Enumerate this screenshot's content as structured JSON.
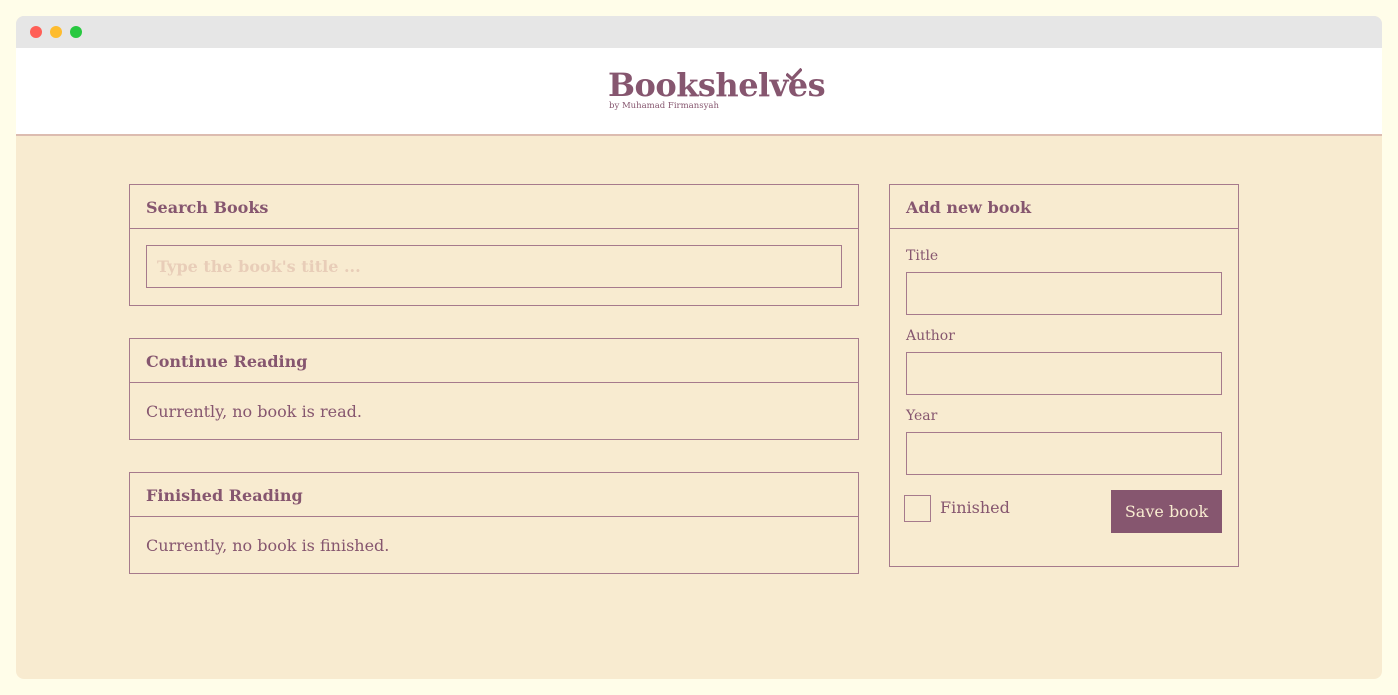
{
  "brand": {
    "title": "Bookshelves",
    "subtitle": "by Muhamad Firmansyah",
    "accent_color": "#86566f",
    "check_icon": "check-icon"
  },
  "search": {
    "heading": "Search Books",
    "placeholder": "Type the book's title ...",
    "value": ""
  },
  "continue_reading": {
    "heading": "Continue Reading",
    "empty_text": "Currently, no book is read."
  },
  "finished_reading": {
    "heading": "Finished Reading",
    "empty_text": "Currently, no book is finished."
  },
  "add_book": {
    "heading": "Add new book",
    "title_label": "Title",
    "title_value": "",
    "author_label": "Author",
    "author_value": "",
    "year_label": "Year",
    "year_value": "",
    "finished_label": "Finished",
    "finished_checked": false,
    "save_label": "Save book"
  },
  "colors": {
    "background": "#f8ebd0",
    "header": "#ffffff",
    "border": "#a67a8c",
    "text": "#86566f"
  }
}
